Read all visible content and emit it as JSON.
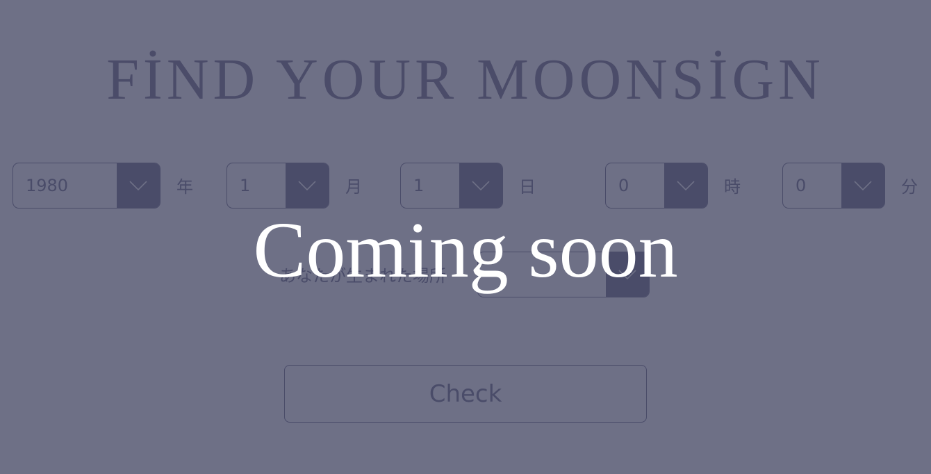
{
  "header": {
    "title": "FİND YOUR MOONSİGN"
  },
  "form": {
    "year": {
      "value": "1980",
      "unit": "年"
    },
    "month": {
      "value": "1",
      "unit": "月"
    },
    "day": {
      "value": "1",
      "unit": "日"
    },
    "hour": {
      "value": "0",
      "unit": "時"
    },
    "minute": {
      "value": "0",
      "unit": "分"
    },
    "birthplace": {
      "label": "あなたが生まれた場所",
      "value": ""
    },
    "check_label": "Check"
  },
  "overlay": {
    "text": "Coming soon"
  },
  "icons": {
    "dropdown": "chevron-down-icon"
  },
  "colors": {
    "background": "#6e7086",
    "foreground": "#4a4c69",
    "overlay_text": "#ffffff"
  }
}
